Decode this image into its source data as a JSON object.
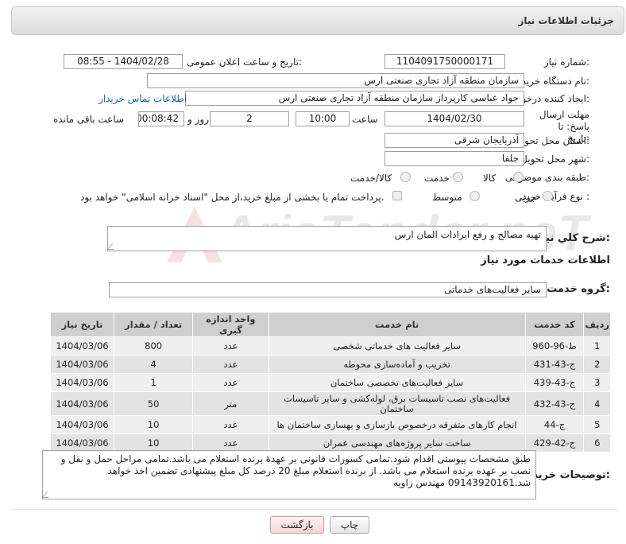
{
  "header": {
    "title": "جزئیات اطلاعات نیاز"
  },
  "fields": {
    "need_number_label": "شماره نیاز:",
    "need_number": "1104091750000171",
    "announce_label": "تاریخ و ساعت اعلان عمومی:",
    "announce_value": "1404/02/28 - 08:55",
    "buyer_org_label": "نام دستگاه خریدار:",
    "buyer_org": "سازمان منطقه آزاد تجاری صنعتی ارس",
    "creator_label": "ایجاد کننده درخواست:",
    "creator": "جواد عباسی کارپرداز سازمان منطقه آزاد تجاری صنعتی ارس",
    "contact_link": "اطلاعات تماس خریدار",
    "deadline_label": "مهلت ارسال پاسخ: تا تاریخ:",
    "deadline_date": "1404/02/30",
    "time_label": "ساعت",
    "deadline_time": "10:00",
    "days_value": "2",
    "days_label": "روز و",
    "remaining_time": "00:08:42",
    "remaining_label": "ساعت باقی مانده",
    "province_label": "استان محل تحویل:",
    "province": "آذربایجان شرقی",
    "city_label": "شهر محل تحویل:",
    "city": "جلفا",
    "category_label": "طبقه بندی موضوعی:",
    "category_options": [
      "کالا",
      "خدمت",
      "کالا/خدمت"
    ],
    "process_label": "نوع فرآیند خرید :",
    "process_options": [
      "جزیی",
      "متوسط"
    ],
    "payment_note": "پرداخت تمام یا بخشی از مبلغ خرید،از محل \"اسناد خزانه اسلامی\" خواهد بود."
  },
  "summary": {
    "label": "شرح کلي نياز:",
    "value": "تهیه مصالح و رفع ایرادات المان ارس"
  },
  "services": {
    "title": "اطلاعات خدمات مورد نیاز",
    "group_label": "گروه خدمت:",
    "group_value": "سایر فعالیت‌های خدماتی"
  },
  "table": {
    "headers": [
      "ردیف",
      "کد خدمت",
      "نام خدمت",
      "واحد اندازه گیری",
      "تعداد / مقدار",
      "تاریخ نیاز"
    ],
    "rows": [
      [
        "1",
        "ط-96-960",
        "سایر فعالیت های خدماتی شخصی",
        "عدد",
        "800",
        "1404/03/06"
      ],
      [
        "2",
        "ج-43-431",
        "تخریب و آماده‌سازی محوطه",
        "عدد",
        "4",
        "1404/03/06"
      ],
      [
        "3",
        "ج-43-439",
        "سایر فعالیت‌های تخصصی ساختمان",
        "عدد",
        "1",
        "1404/03/06"
      ],
      [
        "4",
        "ج-43-432",
        "فعالیت‌های نصب تاسیسات برق، لوله‌کشی و سایر تاسیسات ساختمان",
        "متر",
        "50",
        "1404/03/06"
      ],
      [
        "5",
        "ج-44",
        "انجام کارهای متفرقه درخصوص بازسازی و بهسازی ساختمان ها",
        "عدد",
        "10",
        "1404/03/06"
      ],
      [
        "6",
        "ج-42-429",
        "ساخت سایر پروژه‌های مهندسی عمران",
        "عدد",
        "10",
        "1404/03/06"
      ]
    ]
  },
  "buyer_notes": {
    "label": "توضیحات خریدار:",
    "value": "طبق مشخصات پیوستی اقدام شود.تمامی کسورات قانونی بر عهدهٔ برنده استعلام می باشد.تمامی مراحل حمل و نقل و نصب بر عهده برنده استعلام می باشد. از برنده استعلام مبلغ 20 درصد کل مبلغ پیشنهادی تضمین اخذ خواهد شد.09143920161 مهندس زاویه"
  },
  "buttons": {
    "print": "چاپ",
    "back": "بازگشت"
  },
  "watermark": {
    "text": "AriaTender.neT"
  },
  "colors": {
    "link": "#1a5fb4",
    "header_bg": "#dcdcdc",
    "table_header": "#cfcfcf"
  }
}
